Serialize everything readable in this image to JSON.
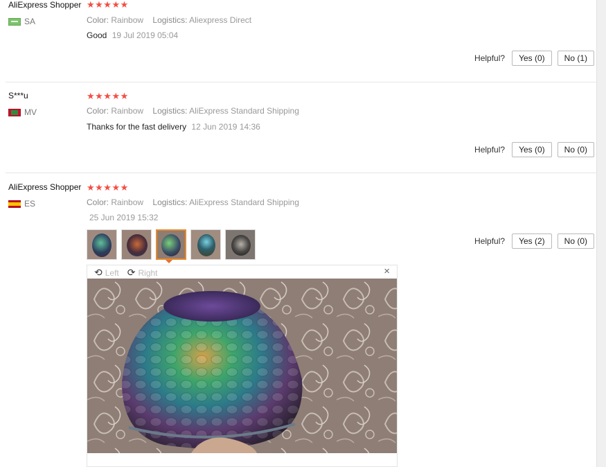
{
  "reviews": [
    {
      "username": "AliExpress Shopper",
      "country_code": "SA",
      "stars": "★★★★★",
      "color_label": "Color:",
      "color_value": "Rainbow",
      "logistics_label": "Logistics:",
      "logistics_value": "Aliexpress Direct",
      "feedback": "Good",
      "date": "19 Jul 2019 05:04",
      "helpful_label": "Helpful?",
      "yes_label": "Yes (0)",
      "no_label": "No (1)"
    },
    {
      "username": "S***u",
      "country_code": "MV",
      "stars": "★★★★★",
      "color_label": "Color:",
      "color_value": "Rainbow",
      "logistics_label": "Logistics:",
      "logistics_value": "AliExpress Standard Shipping",
      "feedback": "Thanks for the fast delivery",
      "date": "12 Jun 2019 14:36",
      "helpful_label": "Helpful?",
      "yes_label": "Yes (0)",
      "no_label": "No (0)"
    },
    {
      "username": "AliExpress Shopper",
      "country_code": "ES",
      "stars": "★★★★★",
      "color_label": "Color:",
      "color_value": "Rainbow",
      "logistics_label": "Logistics:",
      "logistics_value": "AliExpress Standard Shipping",
      "feedback": "",
      "date": "25 Jun 2019 15:32",
      "helpful_label": "Helpful?",
      "yes_label": "Yes (2)",
      "no_label": "No (0)",
      "thumbnail_count": 5,
      "selected_thumbnail": 3
    }
  ],
  "viewer": {
    "rotate_left_label": "Left",
    "rotate_right_label": "Right",
    "rotate_left_icon": "rotate-left-icon",
    "rotate_right_icon": "rotate-right-icon",
    "close_icon": "close-icon",
    "close_glyph": "×"
  },
  "colors": {
    "star": "#f24e43",
    "active_thumb_border": "#e88a2d"
  }
}
